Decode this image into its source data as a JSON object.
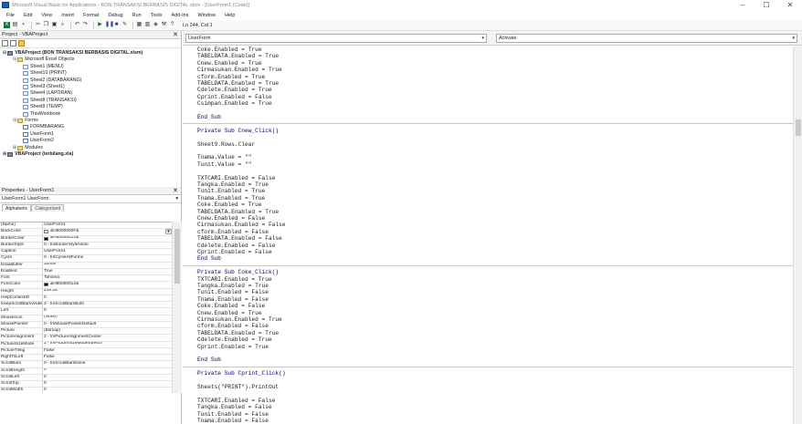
{
  "window": {
    "title": "Microsoft Visual Basic for Applications - BON TRANSAKSI BERBASIS DIGITAL.xlsm - [UserForm1 (Code)]"
  },
  "menu": [
    "File",
    "Edit",
    "View",
    "Insert",
    "Format",
    "Debug",
    "Run",
    "Tools",
    "Add-Ins",
    "Window",
    "Help"
  ],
  "toolbar": {
    "position": "Ln 244, Col 1"
  },
  "project": {
    "title": "Project - VBAProject",
    "tree": [
      {
        "label": "VBAProject (BON TRANSAKSI BERBASIS DIGITAL.xlsm)",
        "depth": 0,
        "icon": "proj",
        "bold": true,
        "exp": "⊟"
      },
      {
        "label": "Microsoft Excel Objects",
        "depth": 1,
        "icon": "fold",
        "exp": "⊟"
      },
      {
        "label": "Sheet1 (MENU)",
        "depth": 2,
        "icon": "sheet"
      },
      {
        "label": "Sheet10 (PRINT)",
        "depth": 2,
        "icon": "sheet"
      },
      {
        "label": "Sheet2 (DATABARANG)",
        "depth": 2,
        "icon": "sheet"
      },
      {
        "label": "Sheet3 (Sheet1)",
        "depth": 2,
        "icon": "sheet"
      },
      {
        "label": "Sheet4 (LAPORAN)",
        "depth": 2,
        "icon": "sheet"
      },
      {
        "label": "Sheet8 (TRANSAKSI)",
        "depth": 2,
        "icon": "sheet"
      },
      {
        "label": "Sheet9 (TEMP)",
        "depth": 2,
        "icon": "sheet"
      },
      {
        "label": "ThisWorkbook",
        "depth": 2,
        "icon": "sheet"
      },
      {
        "label": "Forms",
        "depth": 1,
        "icon": "fold",
        "exp": "⊟"
      },
      {
        "label": "FORMBARANG",
        "depth": 2,
        "icon": "form"
      },
      {
        "label": "UserForm1",
        "depth": 2,
        "icon": "form"
      },
      {
        "label": "UserForm2",
        "depth": 2,
        "icon": "form"
      },
      {
        "label": "Modules",
        "depth": 1,
        "icon": "fold",
        "exp": "⊞"
      },
      {
        "label": "VBAProject (terbilang.xla)",
        "depth": 0,
        "icon": "proj",
        "bold": true,
        "exp": "⊞"
      }
    ]
  },
  "properties": {
    "title": "Properties - UserForm1",
    "object": "UserForm1 UserForm",
    "tab_alpha": "Alphabetic",
    "tab_cat": "Categorized",
    "rows": [
      {
        "name": "(Name)",
        "value": "UserForm1"
      },
      {
        "name": "BackColor",
        "value": "&H8000000F&",
        "swatch": "#f0f0f0"
      },
      {
        "name": "BorderColor",
        "value": "&H80000012&",
        "swatch": "#000000"
      },
      {
        "name": "BorderStyle",
        "value": "0 - fmBorderStyleNone"
      },
      {
        "name": "Caption",
        "value": "UserForm1"
      },
      {
        "name": "Cycle",
        "value": "0 - fmCycleAllForms"
      },
      {
        "name": "DrawBuffer",
        "value": "32000"
      },
      {
        "name": "Enabled",
        "value": "True"
      },
      {
        "name": "Font",
        "value": "Tahoma"
      },
      {
        "name": "ForeColor",
        "value": "&H80000012&",
        "swatch": "#000000"
      },
      {
        "name": "Height",
        "value": "439.25"
      },
      {
        "name": "HelpContextID",
        "value": "0"
      },
      {
        "name": "KeepScrollBarsVisible",
        "value": "3 - fmScrollBarsBoth"
      },
      {
        "name": "Left",
        "value": "0"
      },
      {
        "name": "MouseIcon",
        "value": "(None)"
      },
      {
        "name": "MousePointer",
        "value": "0 - fmMousePointerDefault"
      },
      {
        "name": "Picture",
        "value": "(Bitmap)"
      },
      {
        "name": "PictureAlignment",
        "value": "2 - fmPictureAlignmentCenter"
      },
      {
        "name": "PictureSizeMode",
        "value": "1 - fmPictureSizeModeStretch"
      },
      {
        "name": "PictureTiling",
        "value": "False"
      },
      {
        "name": "RightToLeft",
        "value": "False"
      },
      {
        "name": "ScrollBars",
        "value": "0 - fmScrollBarsNone"
      },
      {
        "name": "ScrollHeight",
        "value": "0"
      },
      {
        "name": "ScrollLeft",
        "value": "0"
      },
      {
        "name": "ScrollTop",
        "value": "0"
      },
      {
        "name": "ScrollWidth",
        "value": "0"
      },
      {
        "name": "ShowModal",
        "value": "True"
      },
      {
        "name": "SpecialEffect",
        "value": "0 - fmSpecialEffectFlat"
      },
      {
        "name": "StartUpPosition",
        "value": "1 - CenterOwner"
      },
      {
        "name": "Tag",
        "value": ""
      },
      {
        "name": "Top",
        "value": "0"
      }
    ]
  },
  "code": {
    "object_combo": "UserForm",
    "proc_combo": "Activate",
    "lines": [
      "Coke.Enabled = True",
      "TABELDATA.Enabled = True",
      "Cnew.Enabled = True",
      "Cirmasukan.Enabled = True",
      "cform.Enabled = True",
      "TABELDATA.Enabled = True",
      "Cdelete.Enabled = True",
      "Cprint.Enabled = False",
      "Csimpan.Enabled = True",
      "",
      "End Sub",
      "---",
      "Private Sub Cnew_Click()",
      "",
      "Sheet9.Rows.Clear",
      "",
      "Tnama.Value = \"\"",
      "Tunit.Value = \"\"",
      "",
      "TXTCARI.Enabled = False",
      "Tangka.Enabled = True",
      "Tunit.Enabled = True",
      "Tnama.Enabled = True",
      "Coke.Enabled = True",
      "TABELDATA.Enabled = True",
      "Cnew.Enabled = False",
      "Cirmasukan.Enabled = False",
      "cform.Enabled = False",
      "TABELDATA.Enabled = False",
      "Cdelete.Enabled = False",
      "Cprint.Enabled = False",
      "End Sub",
      "---",
      "Private Sub Coke_Click()",
      "TXTCARI.Enabled = True",
      "Tangka.Enabled = True",
      "Tunit.Enabled = False",
      "Tnama.Enabled = False",
      "Coke.Enabled = False",
      "Cnew.Enabled = True",
      "Cirmasukan.Enabled = True",
      "cform.Enabled = False",
      "TABELDATA.Enabled = True",
      "Cdelete.Enabled = True",
      "Cprint.Enabled = True",
      "",
      "End Sub",
      "---",
      "Private Sub Cprint_Click()",
      "",
      "Sheets(\"PRINT\").PrintOut",
      "",
      "TXTCARI.Enabled = False",
      "Tangka.Enabled = False",
      "Tunit.Enabled = False",
      "Tnama.Enabled = False"
    ]
  }
}
